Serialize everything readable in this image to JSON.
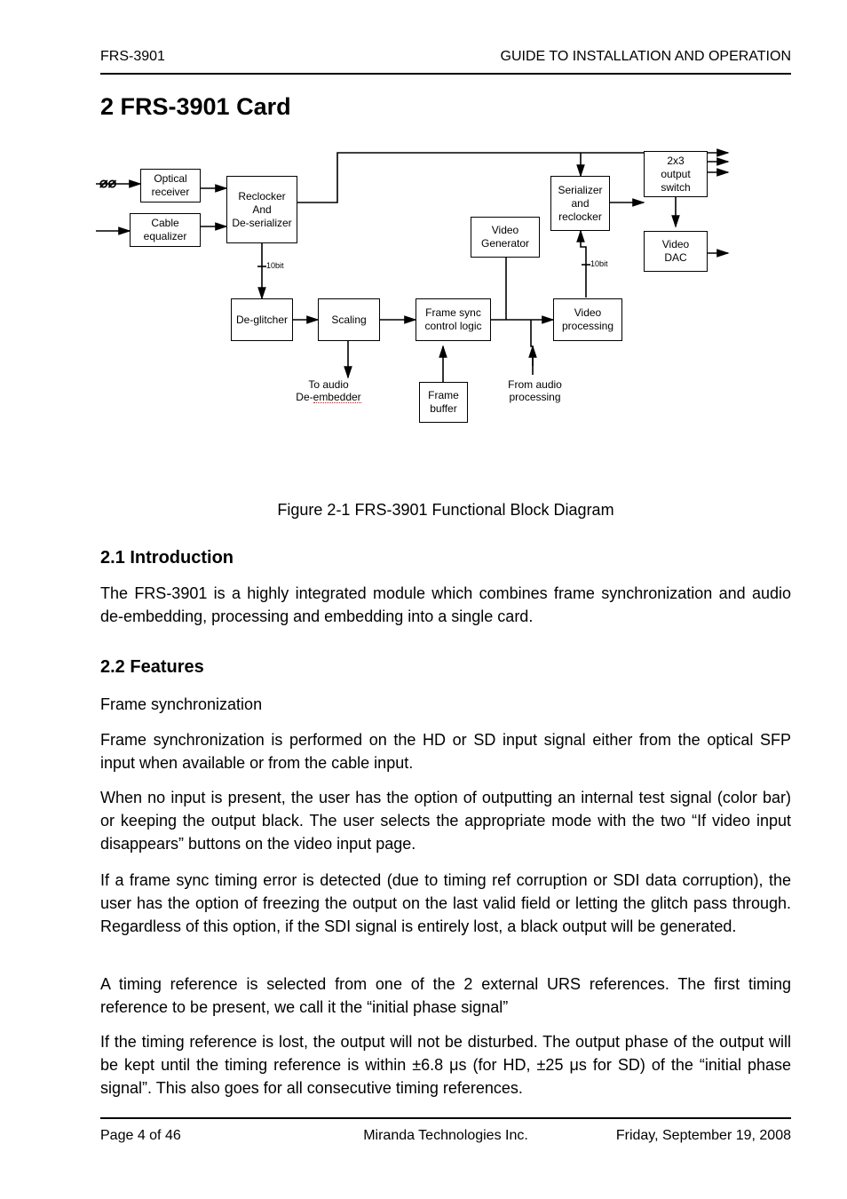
{
  "header": {
    "left": "FRS-3901",
    "right": "GUIDE TO INSTALLATION AND OPERATION"
  },
  "title": "2 FRS-3901 Card",
  "sections": {
    "intro": {
      "heading": "2.1 Introduction",
      "p1": "The FRS-3901 is a highly integrated module which combines frame synchronization and audio de-embedding, processing and embedding into a single card."
    },
    "features": {
      "heading": "2.2 Features",
      "p1": "Frame synchronization is performed on the HD or SD input signal either from the optical SFP input when available or from the cable input.",
      "p2": "When no input is present, the user has the option of outputting an internal test signal (color bar) or keeping the output black. The user selects the appropriate mode with the two “If video input disappears” buttons on the video input page.",
      "p3": "If a frame sync timing error is detected (due to timing ref corruption or SDI data corruption), the user has the option of freezing the output on the last valid field or letting the glitch pass through. Regardless of this option, if the SDI signal is entirely lost, a black output will be generated.",
      "p4": "A timing reference is selected from one of the 2 external URS references. The first timing reference to be present, we call it the “initial phase signal”",
      "p5": "If the timing reference is lost, the output will not be disturbed. The output phase of the output will be kept until the timing reference is within ±6.8 μs (for HD, ±25 μs for SD) of the “initial phase signal”. This also goes for all consecutive timing references."
    }
  },
  "figure": "Figure 2-1 FRS-3901 Functional Block Diagram",
  "diagram": {
    "fiber_symbol": "⑂",
    "boxes": {
      "optical": "Optical\nreceiver",
      "cable": "Cable\nequalizer",
      "reclk": "Reclocker\nAnd\nDe-serializer",
      "deglitch": "De-glitcher",
      "scaling": "Scaling",
      "vgen": "Video\nGenerator",
      "fsync": "Frame sync\ncontrol logic",
      "fbuf": "Frame\nbuffer",
      "vproc": "Video\nprocessing",
      "serial": "Serializer\nand\nreclocker",
      "switch": "2x3\noutput\nswitch",
      "dac": "Video\nDAC"
    },
    "labels": {
      "to_audio": "To audio\nDe-embedder",
      "from_audio": "From audio\nprocessing",
      "tenbit": "10bit",
      "tenbit2": "10bit"
    }
  },
  "footer": {
    "left": "Page 4 of 46",
    "center": "Miranda Technologies Inc.",
    "right": "Friday, September 19, 2008"
  }
}
